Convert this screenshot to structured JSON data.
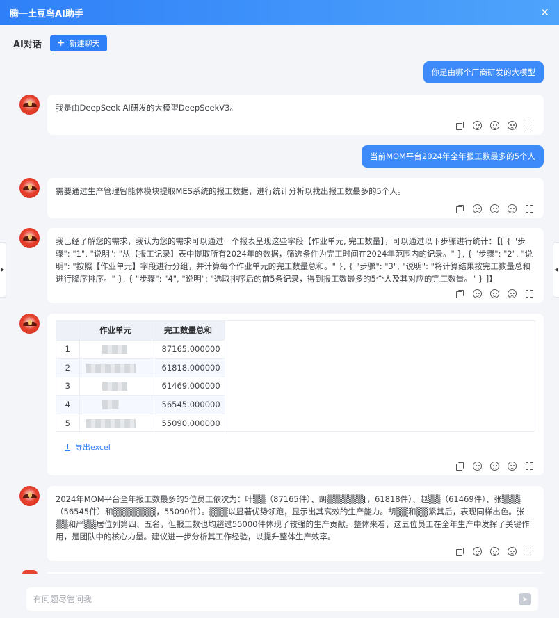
{
  "window": {
    "title": "腾一土豆鸟AI助手",
    "close_icon": "close-icon"
  },
  "header": {
    "title": "AI对话",
    "new_chat_label": "新建聊天"
  },
  "messages": {
    "u1": "你是由哪个厂商研发的大模型",
    "b1": "我是由DeepSeek AI研发的大模型DeepSeekV3。",
    "u2": "当前MOM平台2024年全年报工数最多的5个人",
    "b2": "需要通过生产管理智能体模块提取MES系统的报工数据，进行统计分析以找出报工数最多的5个人。",
    "b3": "我已经了解您的需求，我认为您的需求可以通过一个报表呈现这些字段【作业单元, 完工数量】，可以通过以下步骤进行统计：【[ { \"步骤\": \"1\", \"说明\": \"从【报工记录】表中提取所有2024年的数据，筛选条件为完工时间在2024年范围内的记录。\" }, { \"步骤\": \"2\", \"说明\": \"按照【作业单元】字段进行分组，并计算每个作业单元的完工数量总和。\" }, { \"步骤\": \"3\", \"说明\": \"将计算结果按完工数量总和进行降序排序。\" }, { \"步骤\": \"4\", \"说明\": \"选取排序后的前5条记录，得到报工数最多的5个人及其对应的完工数量。\" } ]】",
    "b5": "2024年MOM平台全年报工数最多的5位员工依次为：叶▒▒（87165件）、胡▒▒▒▒▒▒[，61818件）、赵▒▒（61469件）、张▒▒▒（56545件）和▒▒▒▒▒▒▒，55090件）。▒▒▒以显著优势领跑，显示出其高效的生产能力。胡▒▒和▒▒紧其后，表现同样出色。张▒▒和严▒▒居位列第四、五名，但报工数也均超过55000件体现了较强的生产贡献。整体来看，这五位员工在全年生产中发挥了关键作用，是团队中的核心力量。建议进一步分析其工作经验，以提升整体生产效率。"
  },
  "table": {
    "headers": [
      "",
      "作业单元",
      "完工数量总和"
    ],
    "rows": [
      {
        "idx": "1",
        "value": "87165.000000"
      },
      {
        "idx": "2",
        "value": "61818.000000"
      },
      {
        "idx": "3",
        "value": "61469.000000"
      },
      {
        "idx": "4",
        "value": "56545.000000"
      },
      {
        "idx": "5",
        "value": "55090.000000"
      }
    ],
    "export_label": "导出excel"
  },
  "input": {
    "placeholder": "有问题尽管问我"
  },
  "colors": {
    "accent": "#2f80f8",
    "user_bubble": "#3d8bfa",
    "background": "#f3f5f9"
  }
}
